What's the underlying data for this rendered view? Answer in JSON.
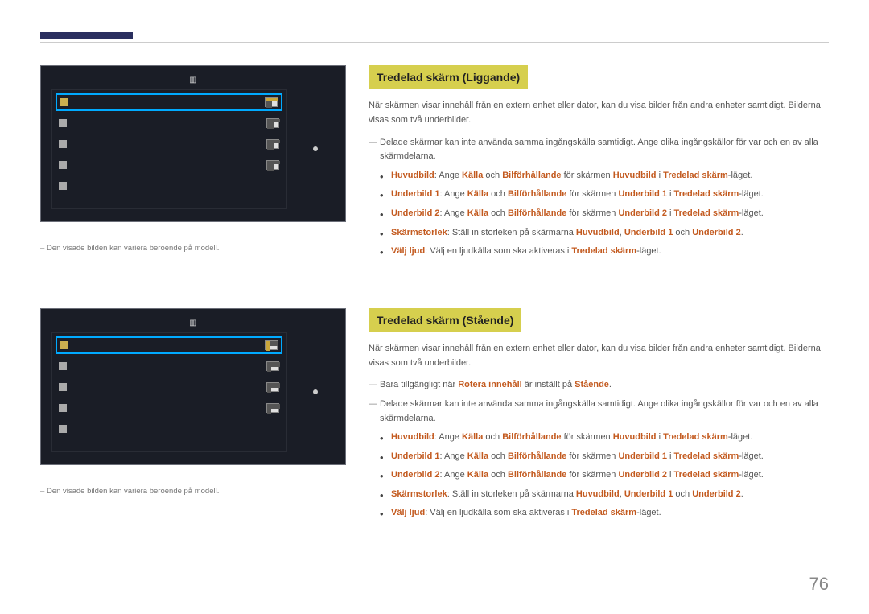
{
  "page_number": "76",
  "footnotes": {
    "disclaimer": "Den visade bilden kan variera beroende på modell."
  },
  "common": {
    "terms": {
      "huvudbild": "Huvudbild",
      "underbild1": "Underbild 1",
      "underbild2": "Underbild 2",
      "kalla": "Källa",
      "bilforhallande": "Bilförhållande",
      "tredelad_skarm": "Tredelad skärm",
      "skarmstorlek": "Skärmstorlek",
      "valj_ljud": "Välj ljud",
      "rotera_innehall": "Rotera innehåll",
      "staende": "Stående"
    },
    "txt": {
      "ange": ": Ange ",
      "och": " och ",
      "for_skarmen": " för skärmen ",
      "i": " i ",
      "laget": "-läget.",
      "skarmstorlek_body": ": Ställ in storleken på skärmarna ",
      "comma": ", ",
      "och2": " och ",
      "period": ".",
      "valj_ljud_body": ": Välj en ljudkälla som ska aktiveras i "
    }
  },
  "sections": [
    {
      "id": "landscape",
      "heading": "Tredelad skärm (Liggande)",
      "intro": "När skärmen visar innehåll från en extern enhet eller dator, kan du visa bilder från andra enheter samtidigt. Bilderna visas som två underbilder.",
      "notes": [
        "Delade skärmar kan inte använda samma ingångskälla samtidigt. Ange olika ingångskällor för var och en av alla skärmdelarna."
      ]
    },
    {
      "id": "portrait",
      "heading": "Tredelad skärm (Stående)",
      "intro": "När skärmen visar innehåll från en extern enhet eller dator, kan du visa bilder från andra enheter samtidigt. Bilderna visas som två underbilder.",
      "notes_pre": "Bara tillgängligt när ",
      "notes_mid": " är inställt på ",
      "notes_post": ".",
      "notes2": "Delade skärmar kan inte använda samma ingångskälla samtidigt. Ange olika ingångskällor för var och en av alla skärmdelarna."
    }
  ]
}
